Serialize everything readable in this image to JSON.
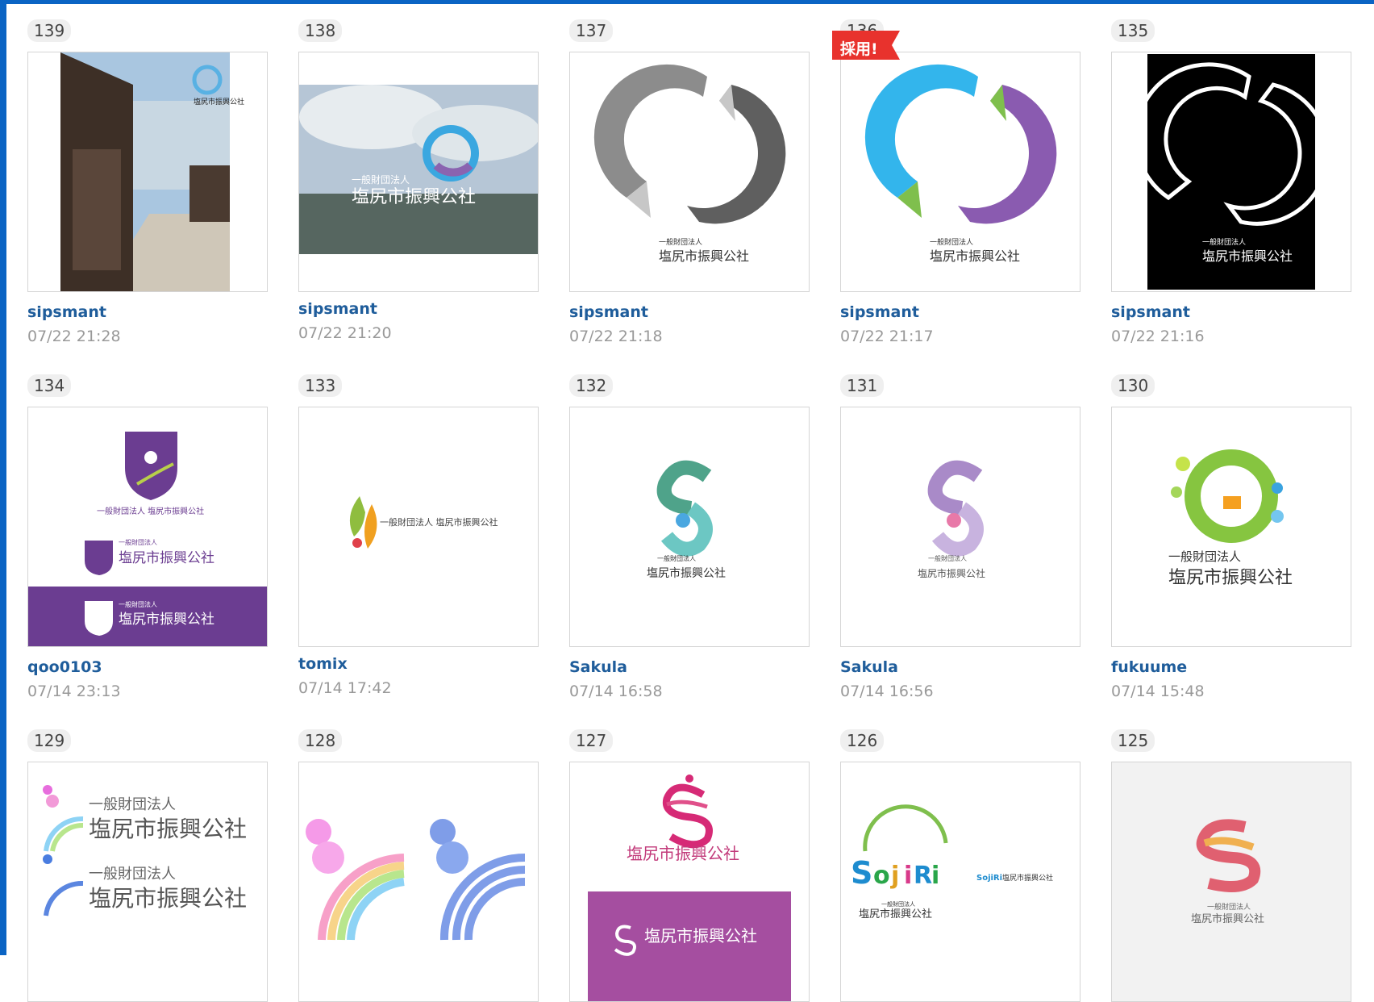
{
  "entries": [
    {
      "no": "139",
      "user": "sipsmant",
      "time": "07/22 21:28",
      "art": "photo-street-logo",
      "text": "塩尻市振興公社"
    },
    {
      "no": "138",
      "user": "sipsmant",
      "time": "07/22 21:20",
      "art": "photo-sky-logo",
      "org": "一般財団法人",
      "text": "塩尻市振興公社"
    },
    {
      "no": "137",
      "user": "sipsmant",
      "time": "07/22 21:18",
      "art": "gray-swirl-logo",
      "org": "一般財団法人",
      "text": "塩尻市振興公社"
    },
    {
      "no": "136",
      "user": "sipsmant",
      "time": "07/22 21:17",
      "art": "color-swirl-logo",
      "badge": "採用!",
      "org": "一般財団法人",
      "text": "塩尻市振興公社"
    },
    {
      "no": "135",
      "user": "sipsmant",
      "time": "07/22 21:16",
      "art": "black-swirl-logo",
      "org": "一般財団法人",
      "text": "塩尻市振興公社"
    },
    {
      "no": "134",
      "user": "qoo0103",
      "time": "07/14 23:13",
      "art": "purple-shield-logo",
      "org": "一般財団法人",
      "text": "塩尻市振興公社"
    },
    {
      "no": "133",
      "user": "tomix",
      "time": "07/14 17:42",
      "art": "flame-logo",
      "text": "一般財団法人 塩尻市振興公社"
    },
    {
      "no": "132",
      "user": "Sakula",
      "time": "07/14 16:58",
      "art": "green-s-logo",
      "org": "一般財団法人",
      "text": "塩尻市振興公社"
    },
    {
      "no": "131",
      "user": "Sakula",
      "time": "07/14 16:56",
      "art": "purple-s-logo",
      "org": "一般財団法人",
      "text": "塩尻市振興公社"
    },
    {
      "no": "130",
      "user": "fukuume",
      "time": "07/14 15:48",
      "art": "green-ring-logo",
      "org": "一般財団法人",
      "text": "塩尻市振興公社"
    },
    {
      "no": "129",
      "art": "rainbow-text-logo",
      "org": "一般財団法人",
      "text": "塩尻市振興公社"
    },
    {
      "no": "128",
      "art": "rainbow-arcs-logo"
    },
    {
      "no": "127",
      "art": "pink-s-logo",
      "text": "塩尻市振興公社"
    },
    {
      "no": "126",
      "art": "shiojiri-letters-logo",
      "org": "一般財団法人",
      "text": "塩尻市振興公社"
    },
    {
      "no": "125",
      "art": "ribbon-s-logo",
      "org": "一般財団法人",
      "text": "塩尻市振興公社"
    }
  ],
  "colors": {
    "frame": "#0a64c4",
    "user_link": "#1f5d9b",
    "time": "#999999",
    "badge_red": "#e8322d"
  }
}
